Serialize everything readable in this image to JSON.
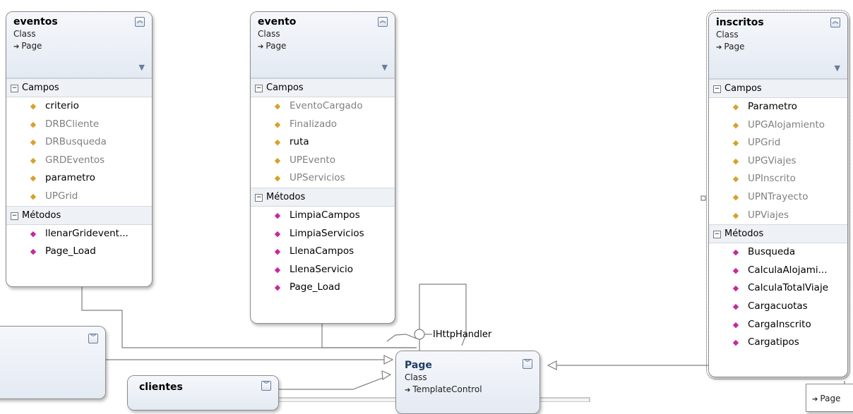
{
  "classes": {
    "eventos": {
      "name": "eventos",
      "kind": "Class",
      "base": "Page",
      "sections": {
        "fields": "Campos",
        "methods": "Métodos"
      },
      "fields": [
        {
          "name": "criterio",
          "visible_style": "private"
        },
        {
          "name": "DRBCliente",
          "visible_style": "protected"
        },
        {
          "name": "DRBusqueda",
          "visible_style": "protected"
        },
        {
          "name": "GRDEventos",
          "visible_style": "protected"
        },
        {
          "name": "parametro",
          "visible_style": "private"
        },
        {
          "name": "UPGrid",
          "visible_style": "protected"
        }
      ],
      "methods": [
        "llenarGridevent...",
        "Page_Load"
      ]
    },
    "evento": {
      "name": "evento",
      "kind": "Class",
      "base": "Page",
      "sections": {
        "fields": "Campos",
        "methods": "Métodos"
      },
      "fields": [
        {
          "name": "EventoCargado",
          "visible_style": "protected"
        },
        {
          "name": "Finalizado",
          "visible_style": "protected"
        },
        {
          "name": "ruta",
          "visible_style": "private"
        },
        {
          "name": "UPEvento",
          "visible_style": "protected"
        },
        {
          "name": "UPServicios",
          "visible_style": "protected"
        }
      ],
      "methods": [
        "LimpiaCampos",
        "LimpiaServicios",
        "LlenaCampos",
        "LlenaServicio",
        "Page_Load"
      ]
    },
    "inscritos": {
      "name": "inscritos",
      "kind": "Class",
      "base": "Page",
      "sections": {
        "fields": "Campos",
        "methods": "Métodos"
      },
      "fields": [
        {
          "name": "Parametro",
          "visible_style": "private"
        },
        {
          "name": "UPGAlojamiento",
          "visible_style": "protected"
        },
        {
          "name": "UPGrid",
          "visible_style": "protected"
        },
        {
          "name": "UPGViajes",
          "visible_style": "protected"
        },
        {
          "name": "UPInscrito",
          "visible_style": "protected"
        },
        {
          "name": "UPNTrayecto",
          "visible_style": "protected"
        },
        {
          "name": "UPViajes",
          "visible_style": "protected"
        }
      ],
      "methods": [
        "Busqueda",
        "CalculaAlojami...",
        "CalculaTotalViaje",
        "Cargacuotas",
        "CargaInscrito",
        "Cargatipos"
      ]
    },
    "page": {
      "name": "Page",
      "kind": "Class",
      "base": "TemplateControl"
    },
    "clientes": {
      "name": "clientes"
    },
    "partial_right": {
      "base": "Page"
    }
  },
  "interface_label": "IHttpHandler",
  "icons": {
    "collapse": "double-chevron-up-icon",
    "expand": "double-chevron-down-icon",
    "field": "field-icon",
    "method": "method-icon",
    "filter": "filter-icon"
  },
  "colors": {
    "header_bg": "#e4eaf3",
    "border": "#8c8c8c",
    "field_icon": "#d6a22b",
    "method_icon": "#c7289e"
  }
}
